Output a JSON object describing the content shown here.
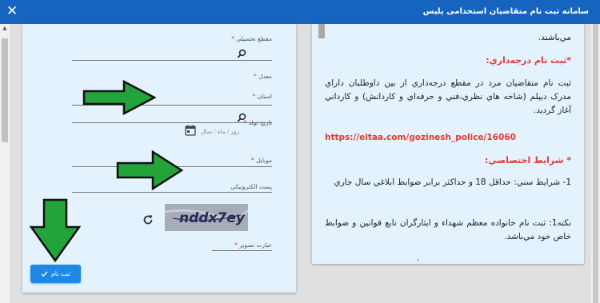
{
  "window": {
    "title": "سامانه ثبت نام متقاضیان استخدامی پلیس",
    "close_icon": "close-icon"
  },
  "form": {
    "fields": [
      {
        "label": "مقطع تحصیلی",
        "required": true,
        "icon": "search-icon"
      },
      {
        "label": "معدل",
        "required": true
      },
      {
        "label": "استان",
        "required": true,
        "icon": "search-icon"
      },
      {
        "label": "تاریخ تولد",
        "required": true
      },
      {
        "label": "موبایل",
        "required": true
      },
      {
        "label": "پست الکترونیکی",
        "required": false
      },
      {
        "label": "عبارت تصویر",
        "required": true
      }
    ],
    "birth_parts": [
      "روز",
      "ماه",
      "سال"
    ],
    "birth_sep": "/",
    "captcha_text": "nddx7ey",
    "submit_label": "ثبت نام"
  },
  "info": {
    "top_text": "مي‌باشند.",
    "degree_heading": "*ثبت نام درجه‌داري:",
    "degree_text": "ثبت نام متقاضيان مرد در مقطع درجه‌داري از بين داوطلبان داراي مدرک ديپلم (شاخه هاي نظري،فني و حرفه‌اي و کاردانش) و کارداني آغاز گرديد.",
    "link_text": "https://eitaa.com/gozinesh_police/16060",
    "conditions_heading": "* شرايط اختصاصي:",
    "condition_1": "1- شرايط سني: حداقل 18 و حداكثر برابر ضوابط ابلاغي سال جاري",
    "note_1": "نكته1: ثبت نام خانواده معظم شهداء و ايثارگران تابع قوانين و ضوابط خاص خود مي‌باشد.",
    "dot": "."
  },
  "colors": {
    "titlebar": "#1565c0",
    "card": "#e3f2fd",
    "accent_red": "#e53935",
    "button": "#1e88e5",
    "arrow_fill": "#22a43a"
  }
}
